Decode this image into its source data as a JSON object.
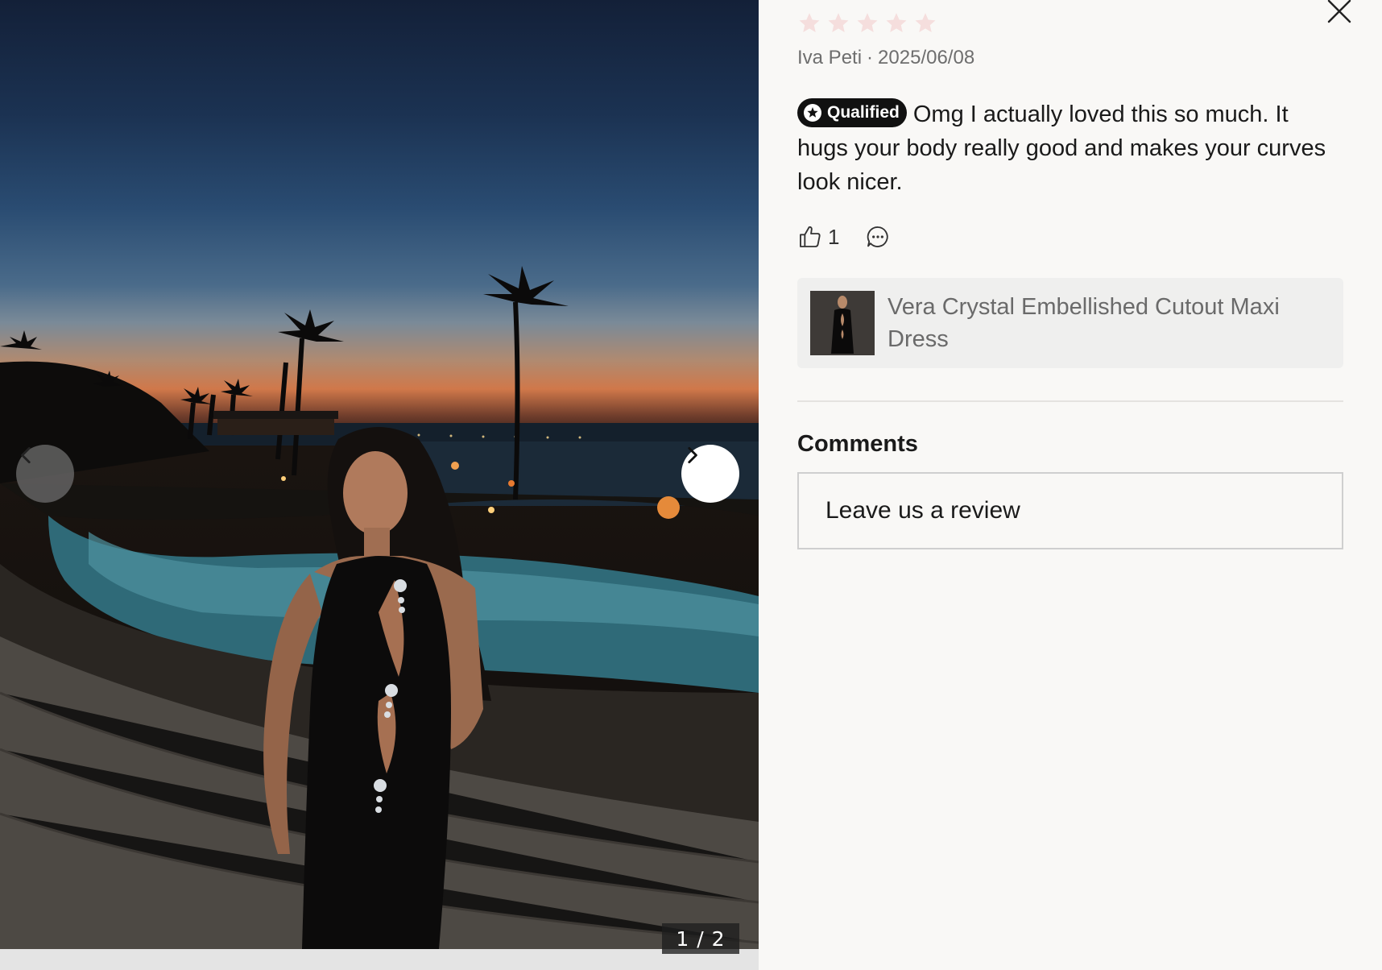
{
  "review": {
    "rating": 5,
    "star_color": "#f5dedd",
    "author": "Iva Peti",
    "separator": "·",
    "date": "2025/06/08",
    "badge_label": "Qualified",
    "text": "Omg I actually loved this so much. It hugs your body really good and makes your curves look nicer.",
    "like_count": "1"
  },
  "product": {
    "name": "Vera Crystal Embellished Cutout Maxi Dress"
  },
  "comments": {
    "title": "Comments",
    "input_placeholder": "Leave us a review"
  },
  "gallery": {
    "counter": "1 / 2",
    "prev_icon": "chevron-left-icon",
    "next_icon": "chevron-right-icon"
  },
  "icons": {
    "close": "close-icon",
    "like": "thumbs-up-icon",
    "comment": "comment-icon",
    "star": "star-icon"
  }
}
